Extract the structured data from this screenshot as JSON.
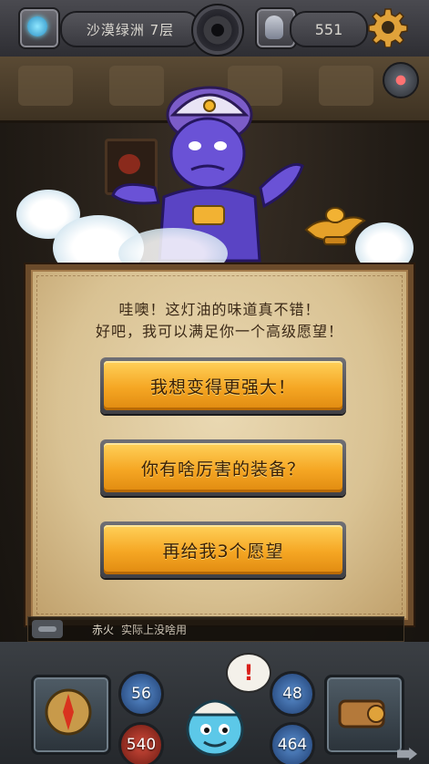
{
  "topbar": {
    "level_label": "沙漠绿洲 7层",
    "coins": "551",
    "icons": [
      "map-icon",
      "dial-icon",
      "mask-icon",
      "gear-icon"
    ]
  },
  "dialog": {
    "line1": "哇噢！这灯油的味道真不错！",
    "line2": "好吧，我可以满足你一个高级愿望！",
    "choices": [
      {
        "label": "我想变得更强大！"
      },
      {
        "label": "你有啥厉害的装备？"
      },
      {
        "label": "再给我3个愿望"
      }
    ]
  },
  "chat": {
    "name": "赤火",
    "text": "实际上没啥用"
  },
  "hud": {
    "attack": "56",
    "hp": "540",
    "defense": "48",
    "mp": "464",
    "alert": "!"
  },
  "colors": {
    "button_gold": "#f5a623",
    "parchment": "#d9c293",
    "frame": "#6b4b2b"
  }
}
